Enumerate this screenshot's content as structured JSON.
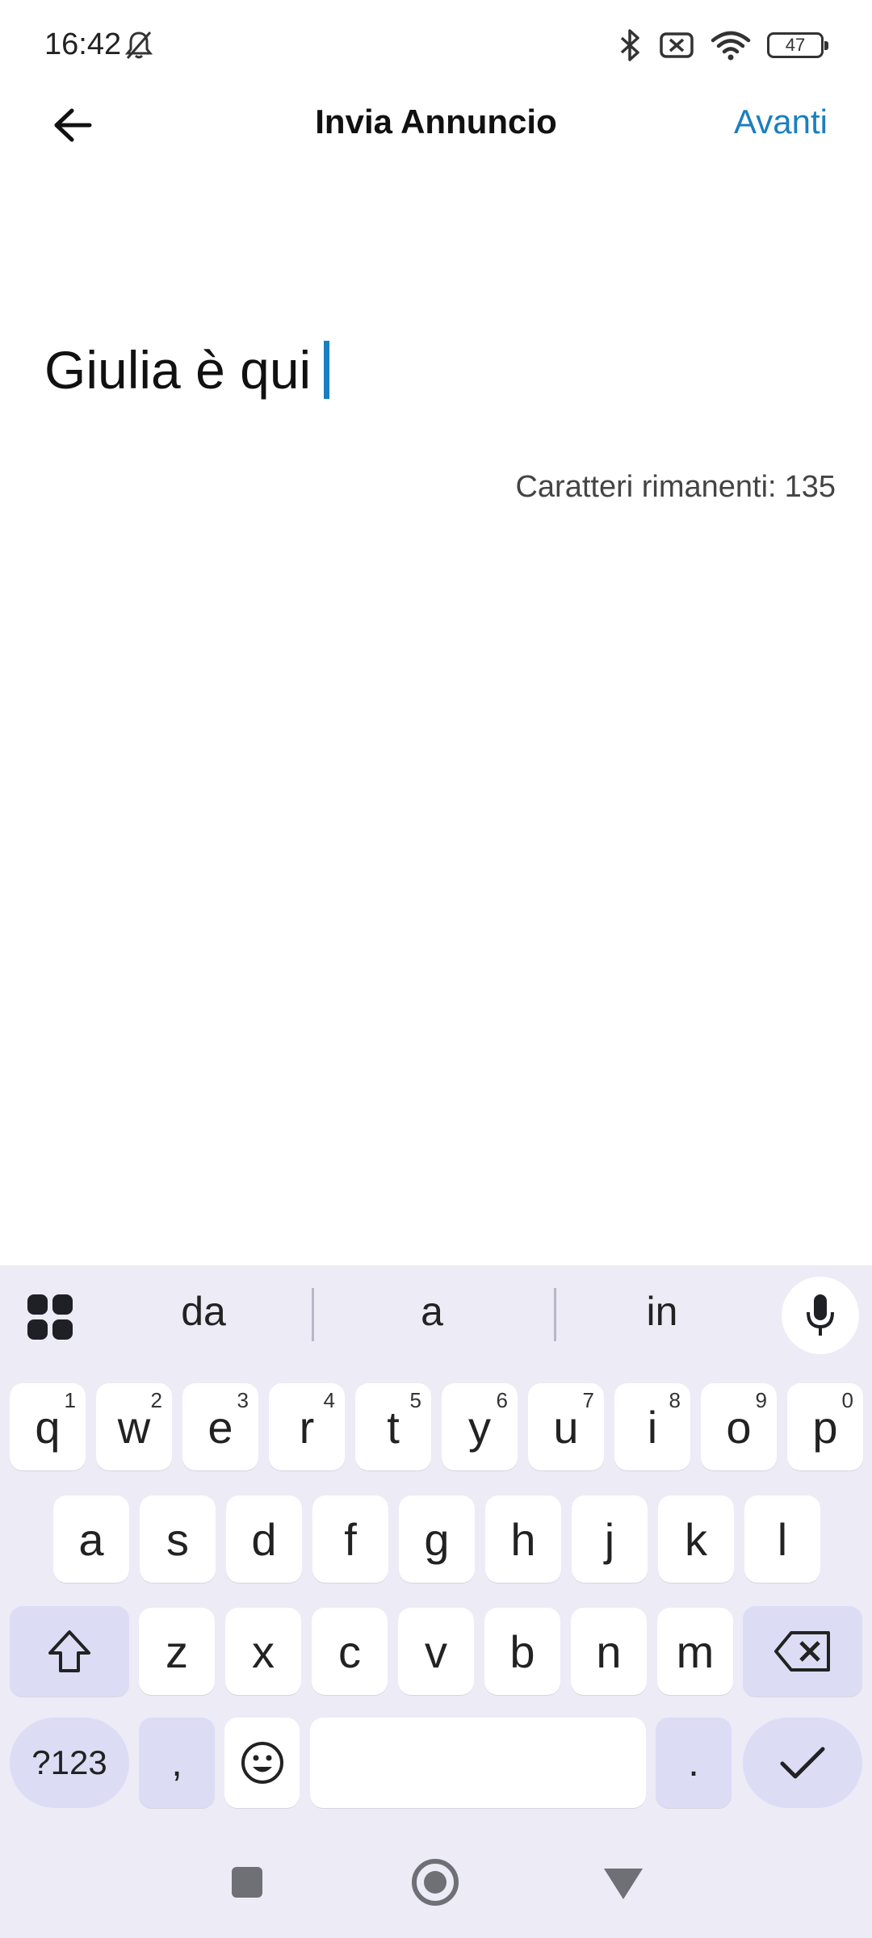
{
  "status_bar": {
    "time": "16:42",
    "battery": "47"
  },
  "header": {
    "title": "Invia Annuncio",
    "next_label": "Avanti"
  },
  "editor": {
    "text": "Giulia è qui",
    "counter_label": "Caratteri rimanenti:",
    "counter_value": "135",
    "accent_color": "#1a7fc0"
  },
  "keyboard": {
    "suggestions": [
      "da",
      "a",
      "in"
    ],
    "row1": [
      {
        "key": "q",
        "sup": "1"
      },
      {
        "key": "w",
        "sup": "2"
      },
      {
        "key": "e",
        "sup": "3"
      },
      {
        "key": "r",
        "sup": "4"
      },
      {
        "key": "t",
        "sup": "5"
      },
      {
        "key": "y",
        "sup": "6"
      },
      {
        "key": "u",
        "sup": "7"
      },
      {
        "key": "i",
        "sup": "8"
      },
      {
        "key": "o",
        "sup": "9"
      },
      {
        "key": "p",
        "sup": "0"
      }
    ],
    "row2": [
      "a",
      "s",
      "d",
      "f",
      "g",
      "h",
      "j",
      "k",
      "l"
    ],
    "row3": [
      "z",
      "x",
      "c",
      "v",
      "b",
      "n",
      "m"
    ],
    "symbols_label": "?123",
    "comma_label": ",",
    "period_label": ".",
    "icons": [
      "apps-grid-icon",
      "microphone-icon",
      "shift-icon",
      "backspace-icon",
      "emoji-icon",
      "checkmark-icon"
    ]
  },
  "navigation": {
    "icons": [
      "recents-icon",
      "home-icon",
      "back-icon"
    ]
  }
}
